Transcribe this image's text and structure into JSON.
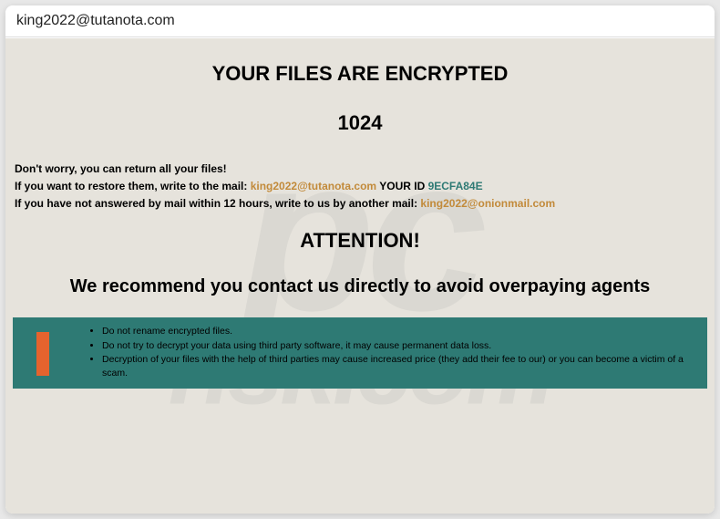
{
  "window": {
    "title": "king2022@tutanota.com"
  },
  "headings": {
    "encrypted": "YOUR FILES ARE ENCRYPTED",
    "number": "1024",
    "attention": "ATTENTION!",
    "recommend": "We recommend you contact us directly to avoid overpaying agents"
  },
  "info": {
    "line1": "Don't worry, you can return all your files!",
    "line2_prefix": "If you want to restore them, write to the mail:    ",
    "line2_email": "king2022@tutanota.com",
    "line2_mid": "    YOUR ID ",
    "line2_id": "9ECFA84E",
    "line3_prefix": "If you have not answered by mail within 12 hours, write to us by another mail:  ",
    "line3_email": "king2022@onionmail.com"
  },
  "warnings": {
    "item1": "Do not rename encrypted files.",
    "item2": "Do not try to decrypt your data using third party software, it may cause permanent data loss.",
    "item3": "Decryption of your files with the help of third parties may cause increased price (they add their fee to our) or you can become a victim of a scam."
  },
  "watermark": {
    "line1": "pc",
    "line2": "risk.com"
  }
}
